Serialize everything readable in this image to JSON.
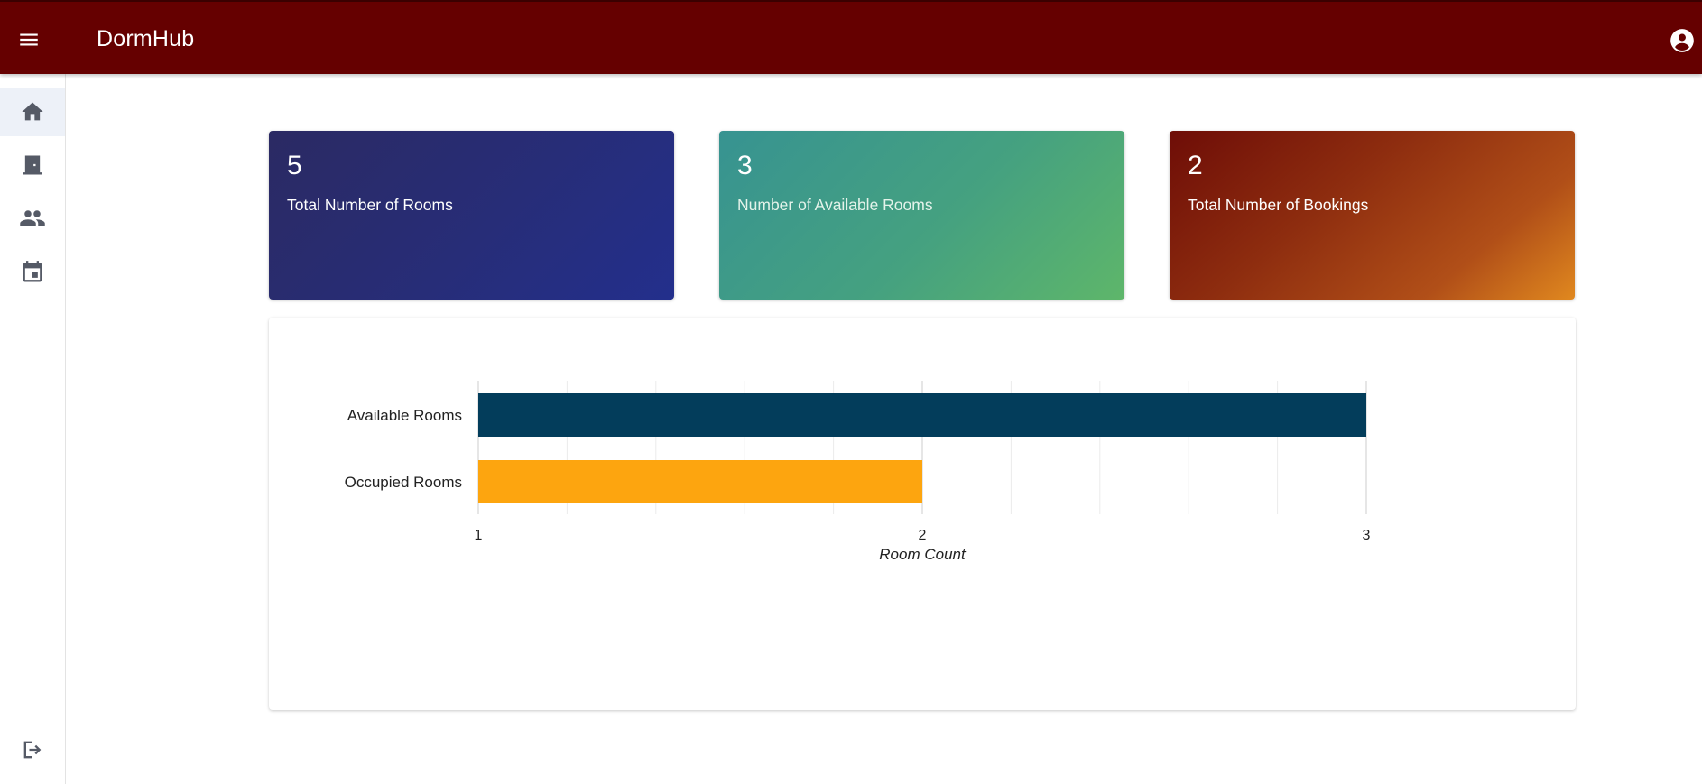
{
  "app": {
    "title": "DormHub"
  },
  "header": {
    "menu_icon": "menu-icon",
    "account_icon": "account-circle-icon"
  },
  "sidebar": {
    "items": [
      {
        "icon": "home-icon",
        "active": true
      },
      {
        "icon": "door-icon",
        "active": false
      },
      {
        "icon": "people-icon",
        "active": false
      },
      {
        "icon": "calendar-icon",
        "active": false
      }
    ],
    "logout_icon": "logout-icon"
  },
  "stats": [
    {
      "value": "5",
      "label": "Total Number of Rooms"
    },
    {
      "value": "3",
      "label": "Number of Available Rooms"
    },
    {
      "value": "2",
      "label": "Total Number of Bookings"
    }
  ],
  "colors": {
    "header": "#650000",
    "available": "#033d5b",
    "occupied": "#fda50f"
  },
  "chart_data": {
    "type": "bar",
    "orientation": "horizontal",
    "categories": [
      "Available Rooms",
      "Occupied Rooms"
    ],
    "values": [
      3,
      2
    ],
    "colors": [
      "#033d5b",
      "#fda50f"
    ],
    "xlabel": "Room Count",
    "ylabel": "",
    "xlim": [
      1,
      3
    ],
    "x_ticks": [
      1,
      2,
      3
    ],
    "grid": true
  }
}
